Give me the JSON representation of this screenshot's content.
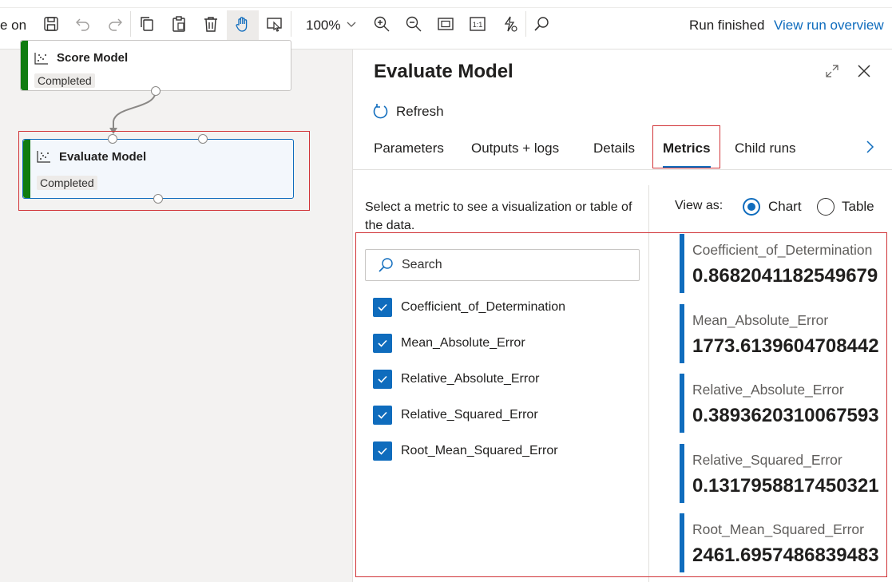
{
  "toolbar": {
    "partial_label": "e on",
    "zoom": "100%",
    "status": "Run finished",
    "overview_link": "View run overview"
  },
  "canvas": {
    "nodes": [
      {
        "title": "Score Model",
        "status": "Completed"
      },
      {
        "title": "Evaluate Model",
        "status": "Completed"
      }
    ]
  },
  "panel": {
    "title": "Evaluate Model",
    "refresh_label": "Refresh",
    "tabs": [
      {
        "label": "Parameters"
      },
      {
        "label": "Outputs + logs"
      },
      {
        "label": "Details"
      },
      {
        "label": "Metrics"
      },
      {
        "label": "Child runs"
      }
    ],
    "active_tab": "Metrics",
    "hint": "Select a metric to see a visualization or table of the data.",
    "view_as_label": "View as:",
    "view_options": [
      "Chart",
      "Table"
    ],
    "view_selected": "Chart",
    "search_placeholder": "Search",
    "metric_checkboxes": [
      {
        "label": "Coefficient_of_Determination",
        "checked": true
      },
      {
        "label": "Mean_Absolute_Error",
        "checked": true
      },
      {
        "label": "Relative_Absolute_Error",
        "checked": true
      },
      {
        "label": "Relative_Squared_Error",
        "checked": true
      },
      {
        "label": "Root_Mean_Squared_Error",
        "checked": true
      }
    ],
    "metric_cards": [
      {
        "name": "Coefficient_of_Determination",
        "value": "0.8682041182549679"
      },
      {
        "name": "Mean_Absolute_Error",
        "value": "1773.6139604708442"
      },
      {
        "name": "Relative_Absolute_Error",
        "value": "0.3893620310067593"
      },
      {
        "name": "Relative_Squared_Error",
        "value": "0.1317958817450321"
      },
      {
        "name": "Root_Mean_Squared_Error",
        "value": "2461.6957486839483"
      }
    ]
  },
  "colors": {
    "accent": "#0f6cbd",
    "success": "#107c10",
    "highlight": "#d13438"
  }
}
